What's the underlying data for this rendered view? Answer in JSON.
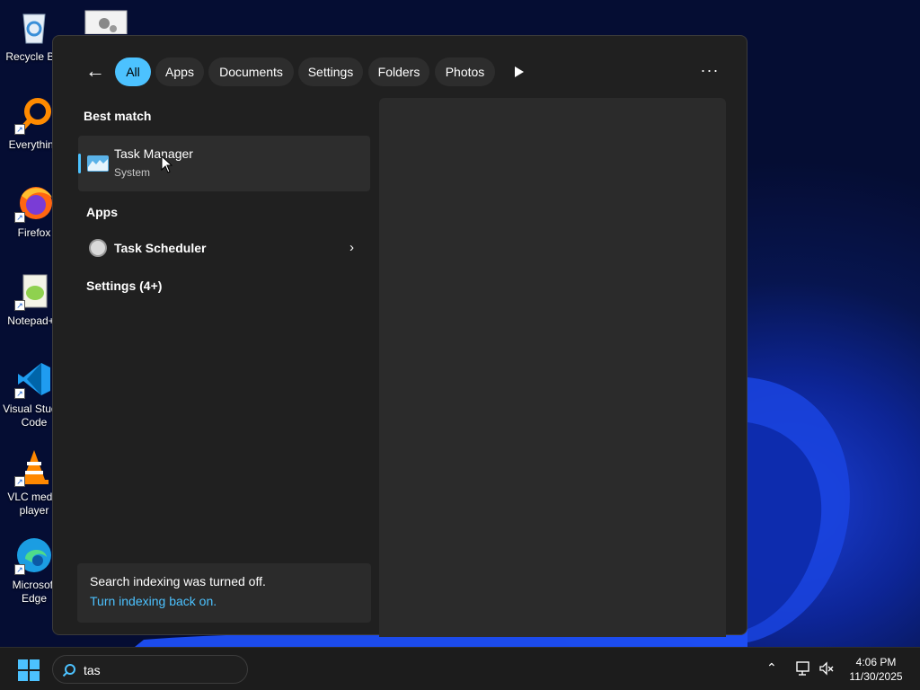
{
  "desktop": {
    "icons": [
      {
        "label": "Recycle Bin",
        "icon": "recycle-bin-icon"
      },
      {
        "label": "",
        "icon": "settings-file-icon"
      },
      {
        "label": "Everything",
        "icon": "everything-search-icon"
      },
      {
        "label": "Firefox",
        "icon": "firefox-icon"
      },
      {
        "label": "Notepad++",
        "icon": "notepad-plus-plus-icon"
      },
      {
        "label": "Visual Studio Code",
        "icon": "vscode-icon"
      },
      {
        "label": "VLC media player",
        "icon": "vlc-icon"
      },
      {
        "label": "Microsoft Edge",
        "icon": "edge-icon"
      }
    ]
  },
  "search_panel": {
    "filters": [
      {
        "label": "All",
        "active": true
      },
      {
        "label": "Apps",
        "active": false
      },
      {
        "label": "Documents",
        "active": false
      },
      {
        "label": "Settings",
        "active": false
      },
      {
        "label": "Folders",
        "active": false
      },
      {
        "label": "Photos",
        "active": false
      }
    ],
    "best_match_heading": "Best match",
    "best_match": {
      "title": "Task Manager",
      "subtitle": "System",
      "icon": "task-manager-icon"
    },
    "apps_heading": "Apps",
    "apps": [
      {
        "title": "Task Scheduler",
        "icon": "task-scheduler-icon"
      }
    ],
    "settings_heading": "Settings (4+)",
    "notice": {
      "message": "Search indexing was turned off.",
      "link": "Turn indexing back on."
    }
  },
  "taskbar": {
    "search_value": "tas",
    "clock": {
      "time": "4:06 PM",
      "date": "11/30/2025"
    }
  },
  "colors": {
    "accent": "#4cc2ff",
    "panel_bg": "#202020",
    "taskbar_bg": "#1c1c1c"
  }
}
